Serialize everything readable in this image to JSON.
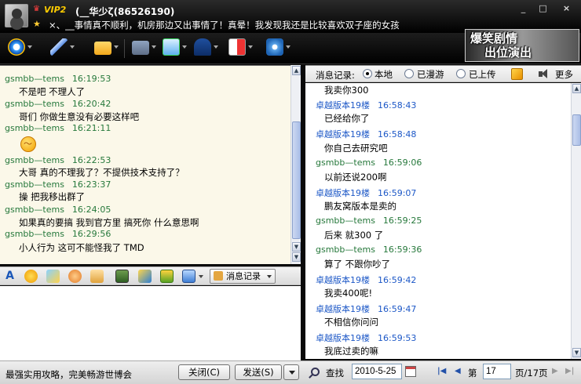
{
  "header": {
    "vip_badge": "VIP2",
    "nickname": "(__华少ζ(86526190)",
    "signature": "×、__事情真不顺利，机房那边又出事情了！真晕！我发现我还是比较喜欢双子座的女孩",
    "window_buttons": [
      "_",
      "□",
      "×"
    ]
  },
  "toolbar": {
    "icons": [
      "webcam-icon",
      "microphone-icon",
      "folder-icon",
      "email-icon",
      "add-contact-icon",
      "police-cap-icon",
      "game-icon",
      "settings-icon"
    ],
    "banner_line1": "爆笑剧情",
    "banner_line2": "出位演出"
  },
  "chat": {
    "messages": [
      {
        "sender": "gsmbb—tems",
        "time": "16:19:53",
        "text": "不是吧 不理人了"
      },
      {
        "sender": "gsmbb—tems",
        "time": "16:20:42",
        "text": "哥们 你做生意没有必要这样吧"
      },
      {
        "sender": "gsmbb—tems",
        "time": "16:21:11",
        "text": ""
      },
      {
        "sender": "gsmbb—tems",
        "time": "16:22:53",
        "text": "大哥 真的不理我了？不提供技术支持了？"
      },
      {
        "sender": "gsmbb—tems",
        "time": "16:23:37",
        "text": "操 把我移出群了"
      },
      {
        "sender": "gsmbb—tems",
        "time": "16:24:05",
        "text": "如果真的要搞 我到官方里 搞死你 什么意思啊"
      },
      {
        "sender": "gsmbb—tems",
        "time": "16:29:56",
        "text": "小人行为 这可不能怪我了 TMD"
      }
    ]
  },
  "input_toolbar": {
    "icons": [
      "font-icon",
      "emoji-icon",
      "magic-emoji-icon",
      "smile-icon",
      "hand-icon",
      "screenshot-icon",
      "image-icon",
      "gift-icon",
      "screen-icon"
    ],
    "record_label": "消息记录"
  },
  "bottom": {
    "ad_text": "最强实用攻略，完美畅游世博会",
    "close_label": "关闭(C)",
    "send_label": "发送(S)"
  },
  "history": {
    "label": "消息记录:",
    "options": [
      "本地",
      "已漫游",
      "已上传"
    ],
    "selected": "本地",
    "more_label": "更多",
    "messages": [
      {
        "sender": "",
        "time": "",
        "text": "我卖你300",
        "role": "other"
      },
      {
        "sender": "卓越版本19楼",
        "time": "16:58:43",
        "text": "已经给你了",
        "role": "other"
      },
      {
        "sender": "卓越版本19楼",
        "time": "16:58:48",
        "text": "你自己去研究吧",
        "role": "other"
      },
      {
        "sender": "gsmbb—tems",
        "time": "16:59:06",
        "text": "以前还说200啊",
        "role": "me"
      },
      {
        "sender": "卓越版本19楼",
        "time": "16:59:07",
        "text": "鹏友窝版本是卖的",
        "role": "other"
      },
      {
        "sender": "gsmbb—tems",
        "time": "16:59:25",
        "text": "后来 就300 了",
        "role": "me"
      },
      {
        "sender": "gsmbb—tems",
        "time": "16:59:36",
        "text": "算了 不跟你吵了",
        "role": "me"
      },
      {
        "sender": "卓越版本19楼",
        "time": "16:59:42",
        "text": "我卖400呢!",
        "role": "other"
      },
      {
        "sender": "卓越版本19楼",
        "time": "16:59:47",
        "text": "不相信你问问",
        "role": "other"
      },
      {
        "sender": "卓越版本19楼",
        "time": "16:59:53",
        "text": "我底过卖的嘛",
        "role": "other"
      }
    ],
    "find_label": "查找",
    "date": "2010-5-25",
    "page_prefix": "第",
    "page": "17",
    "page_suffix": "页/17页"
  }
}
